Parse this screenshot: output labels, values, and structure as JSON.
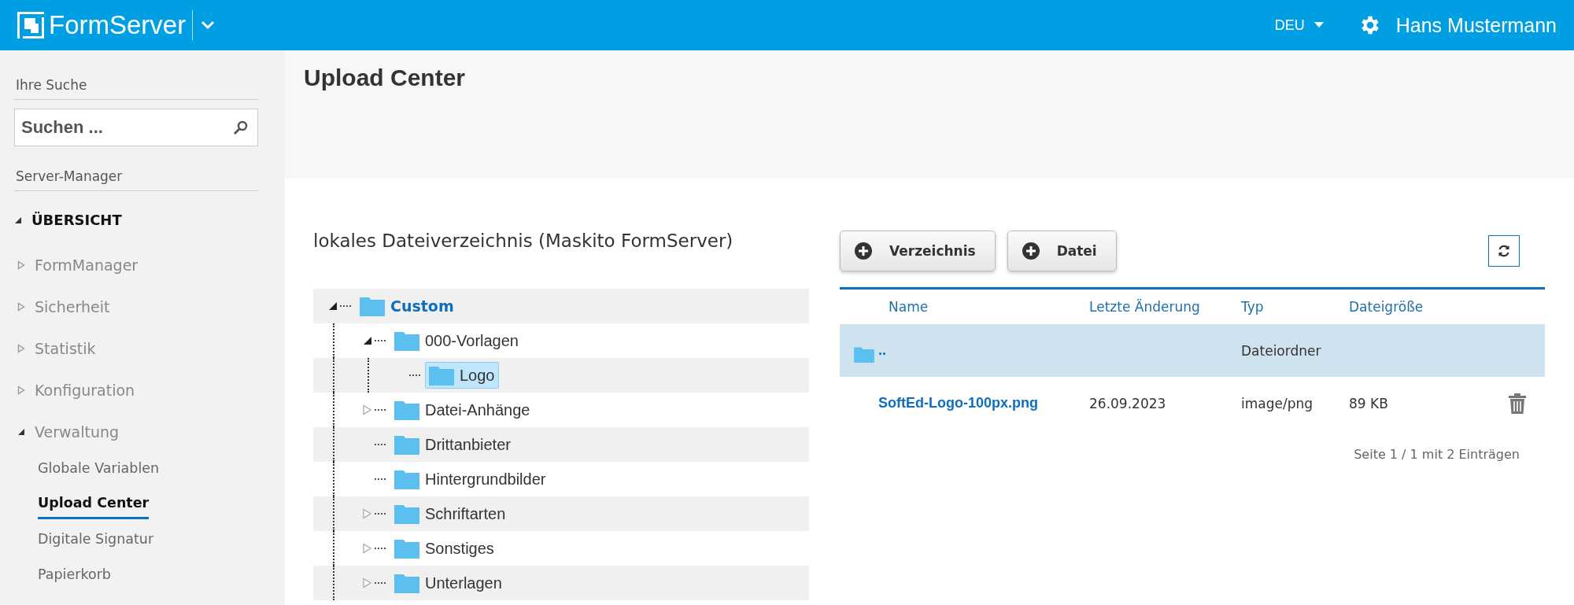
{
  "header": {
    "app_name": "FormServer",
    "language": "DEU",
    "user": "Hans Mustermann"
  },
  "sidebar": {
    "search_label": "Ihre Suche",
    "search": {
      "placeholder": "Suchen ..."
    },
    "section_label": "Server-Manager",
    "nav": {
      "title": "ÜBERSICHT",
      "expanded": true,
      "items": [
        {
          "label": "FormManager",
          "expanded": false
        },
        {
          "label": "Sicherheit",
          "expanded": false
        },
        {
          "label": "Statistik",
          "expanded": false
        },
        {
          "label": "Konfiguration",
          "expanded": false
        },
        {
          "label": "Verwaltung",
          "expanded": true,
          "children": [
            {
              "label": "Globale Variablen",
              "selected": false
            },
            {
              "label": "Upload Center",
              "selected": true
            },
            {
              "label": "Digitale Signatur",
              "selected": false
            },
            {
              "label": "Papierkorb",
              "selected": false
            }
          ]
        }
      ]
    }
  },
  "page_title": "Upload Center",
  "directory": {
    "title": "lokales Dateiverzeichnis (Maskito FormServer)",
    "tree": [
      {
        "label": "Custom",
        "expanded": true,
        "selected": false,
        "children": [
          {
            "label": "000-Vorlagen",
            "expanded": true,
            "selected": false,
            "children": [
              {
                "label": "Logo",
                "selected": true
              }
            ]
          },
          {
            "label": "Datei-Anhänge",
            "expanded": false,
            "selected": false
          },
          {
            "label": "Drittanbieter",
            "selected": false
          },
          {
            "label": "Hintergrundbilder",
            "selected": false
          },
          {
            "label": "Schriftarten",
            "expanded": false,
            "selected": false
          },
          {
            "label": "Sonstiges",
            "expanded": false,
            "selected": false
          },
          {
            "label": "Unterlagen",
            "expanded": false,
            "selected": false
          }
        ]
      }
    ]
  },
  "files": {
    "buttons": [
      "Verzeichnis",
      "Datei"
    ],
    "columns": [
      "Name",
      "Letzte Änderung",
      "Typ",
      "Dateigröße"
    ],
    "rows": [
      {
        "kind": "folder",
        "selected": true,
        "name": "..",
        "modified": "",
        "type": "Dateiordner",
        "size": ""
      },
      {
        "kind": "file",
        "selected": false,
        "name": "SoftEd-Logo-100px.png",
        "modified": "26.09.2023",
        "type": "image/png",
        "size": "89 KB"
      }
    ],
    "pagination": "Seite 1 / 1 mit 2 Einträgen"
  }
}
